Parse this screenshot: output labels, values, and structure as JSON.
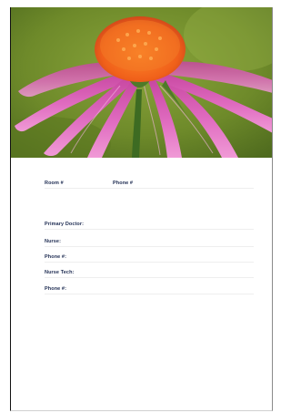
{
  "header_image": {
    "subject": "purple coneflower",
    "colors": {
      "background": "#6e8a2a",
      "petals": "#d65ab4",
      "center": "#f06a1e",
      "stem": "#3d6b22"
    }
  },
  "form": {
    "room_label": "Room #",
    "room_phone_label": "Phone #",
    "primary_doctor_label": "Primary Doctor:",
    "nurse_label": "Nurse:",
    "nurse_phone_label": "Phone #:",
    "nurse_tech_label": "Nurse Tech:",
    "nurse_tech_phone_label": "Phone #:"
  }
}
